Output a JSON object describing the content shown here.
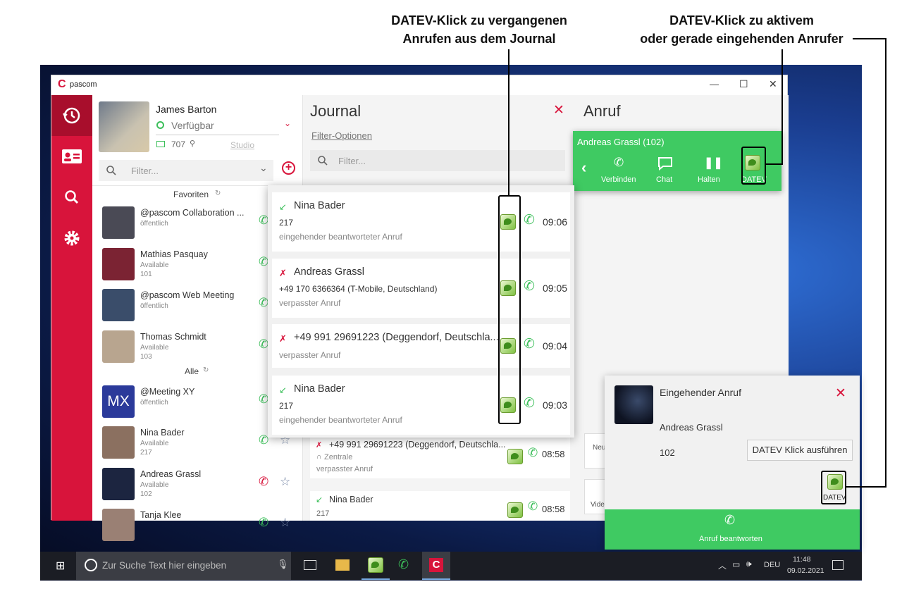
{
  "annotations": {
    "journal_note_line1": "DATEV-Klick zu vergangenen",
    "journal_note_line2": "Anrufen aus dem Journal",
    "active_note_line1": "DATEV-Klick zu aktivem",
    "active_note_line2": "oder gerade eingehenden Anrufer"
  },
  "window": {
    "app_name": "pascom",
    "minimize": "—",
    "maximize": "☐",
    "close": "✕"
  },
  "profile": {
    "name": "James Barton",
    "status": "Verfügbar",
    "extension": "707",
    "location": "Studio"
  },
  "contacts_filter_placeholder": "Filter...",
  "contact_sections": {
    "favorites": "Favoriten",
    "all": "Alle"
  },
  "contacts": [
    {
      "name": "@pascom Collaboration ...",
      "status": "öffentlich",
      "ext": "",
      "avatar_color": "#4a4a55"
    },
    {
      "name": "Mathias Pasquay",
      "status": "Available",
      "ext": "101",
      "avatar_color": "#7b2333"
    },
    {
      "name": "@pascom Web Meeting",
      "status": "öffentlich",
      "ext": "",
      "avatar_color": "#3a4d6a"
    },
    {
      "name": "Thomas Schmidt",
      "status": "Available",
      "ext": "103",
      "avatar_color": "#b8a58f"
    },
    {
      "name": "@Meeting XY",
      "status": "öffentlich",
      "ext": "",
      "avatar_color": "#2b3a9a",
      "initials": "MX"
    },
    {
      "name": "Nina Bader",
      "status": "Available",
      "ext": "217",
      "avatar_color": "#8b7060"
    },
    {
      "name": "Andreas Grassl",
      "status": "Available",
      "ext": "102",
      "avatar_color": "#1c2540"
    },
    {
      "name": "Tanja Klee",
      "status": "",
      "ext": "",
      "avatar_color": "#9a8074"
    }
  ],
  "journal": {
    "title": "Journal",
    "filter_options": "Filter-Optionen",
    "filter_placeholder": "Filter...",
    "popup_entries": [
      {
        "name": "Nina Bader",
        "number": "217",
        "type": "eingehender beantworteter Anruf",
        "time": "09:06",
        "missed": false
      },
      {
        "name": "Andreas Grassl",
        "number": "+49 170 6366364 (T-Mobile, Deutschland)",
        "type": "verpasster Anruf",
        "time": "09:05",
        "missed": true
      },
      {
        "name": "+49 991 29691223 (Deggendorf, Deutschla...",
        "number": "",
        "type": "verpasster Anruf",
        "time": "09:04",
        "missed": true
      },
      {
        "name": "Nina Bader",
        "number": "217",
        "type": "eingehender beantworteter Anruf",
        "time": "09:03",
        "missed": false
      }
    ],
    "lower_entries": [
      {
        "name": "+49 991 29691223 (Deggendorf, Deutschla...",
        "sub": "Zentrale",
        "type": "verpasster Anruf",
        "time": "08:58"
      },
      {
        "name": "Nina Bader",
        "sub": "217",
        "type": "",
        "time": "08:58"
      }
    ]
  },
  "anruf": {
    "title": "Anruf",
    "active_call": "Andreas Grassl (102)",
    "actions": [
      "Verbinden",
      "Chat",
      "Halten",
      "DATEV"
    ],
    "side_labels": [
      "Neu",
      "Vide"
    ]
  },
  "incoming": {
    "title": "Eingehender Anruf",
    "caller": "Andreas Grassl",
    "number": "102",
    "datev_button": "DATEV Klick ausführen",
    "datev_label": "DATEV",
    "answer": "Anruf beantworten"
  },
  "taskbar": {
    "search_placeholder": "Zur Suche Text hier eingeben",
    "lang": "DEU",
    "time": "11:48",
    "date": "09.02.2021"
  },
  "colors": {
    "accent": "#d8143b",
    "green": "#3fca62",
    "missed": "#d8143b"
  }
}
